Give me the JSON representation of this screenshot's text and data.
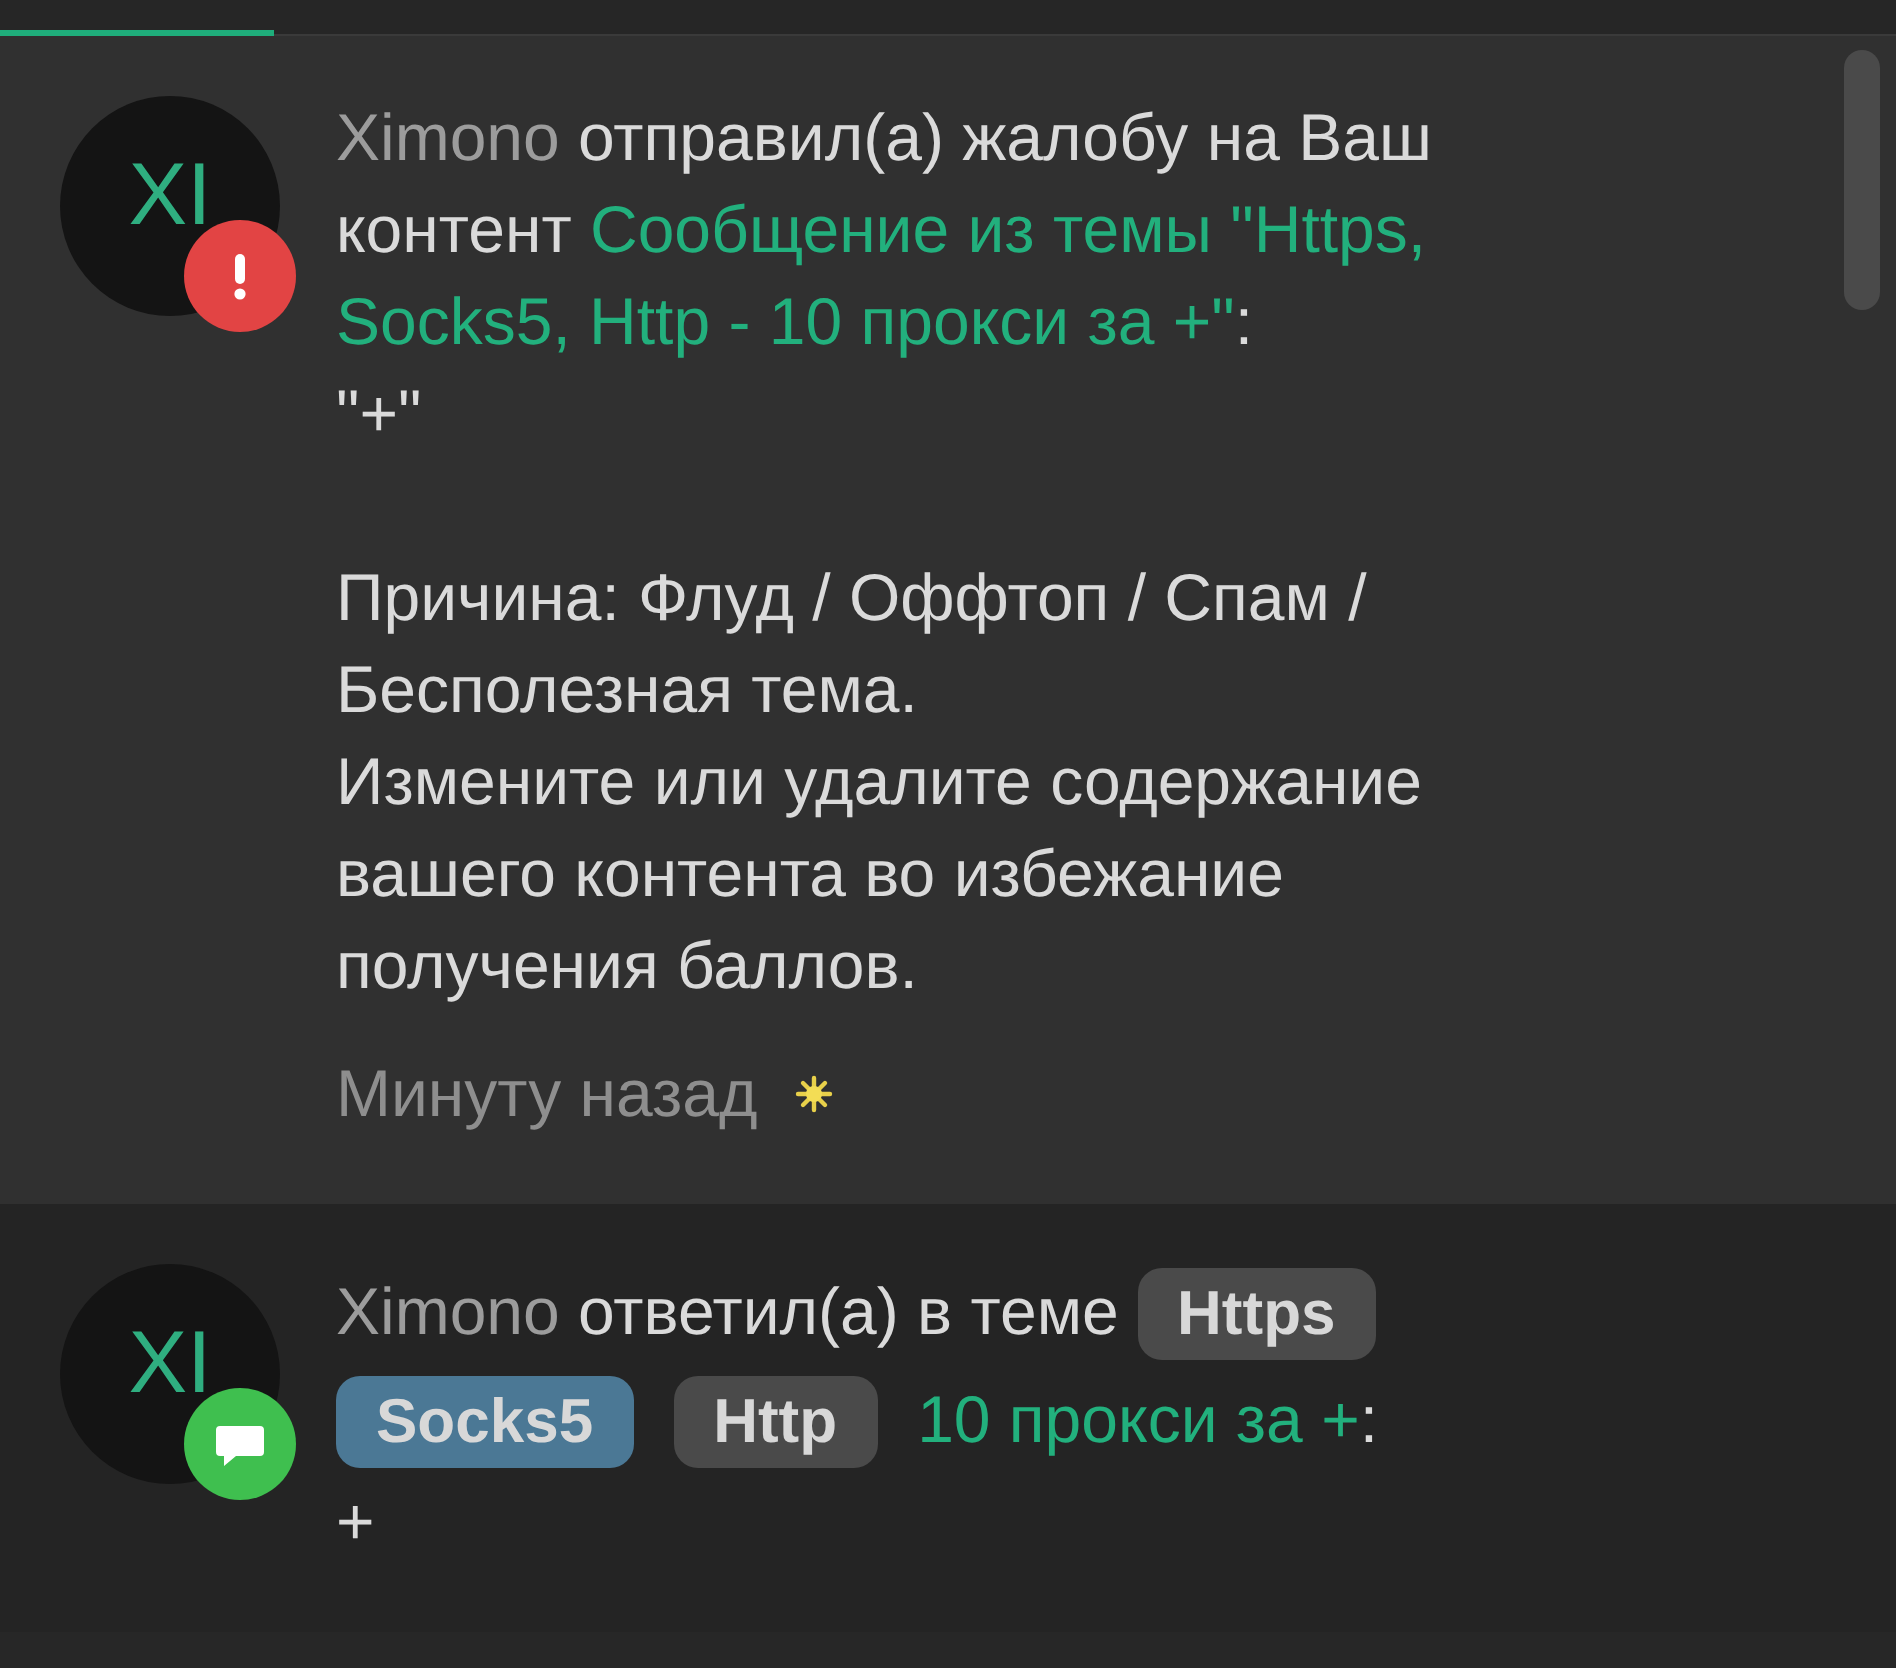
{
  "progress": {
    "level": 0.145
  },
  "notifications": [
    {
      "kind": "report",
      "unread": true,
      "avatar": "XI",
      "actor": "Ximono",
      "action": "отправил(а) жалобу на Ваш контент",
      "link_lines": [
        "Сообщение из темы \"Https,",
        "Socks5, Http - 10 прокси за +\""
      ],
      "suffix": ":",
      "paragraphs": [
        [
          "\"+\""
        ],
        [
          "Причина: Флуд / Оффтоп / Спам / Бесполезная тема.",
          "Измените или удалите содержание вашего контента во избежание получения баллов."
        ]
      ],
      "time": "Минуту назад",
      "new": true
    },
    {
      "kind": "reply",
      "unread": false,
      "avatar": "XI",
      "actor": "Ximono",
      "action": "ответил(а) в теме",
      "tags": [
        {
          "label": "Https",
          "color": "#4a4a4a"
        },
        {
          "label": "Socks5",
          "color": "#4b7895"
        },
        {
          "label": "Http",
          "color": "#4a4a4a"
        }
      ],
      "link_lines": [
        "10 прокси за +"
      ],
      "suffix": ":",
      "paragraphs": [
        [
          "+"
        ]
      ]
    }
  ]
}
